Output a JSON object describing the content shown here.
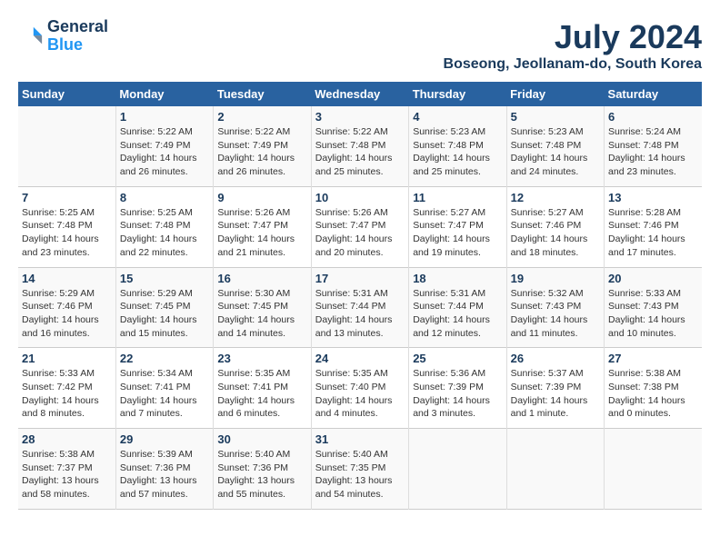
{
  "logo": {
    "line1": "General",
    "line2": "Blue"
  },
  "title": "July 2024",
  "subtitle": "Boseong, Jeollanam-do, South Korea",
  "days_header": [
    "Sunday",
    "Monday",
    "Tuesday",
    "Wednesday",
    "Thursday",
    "Friday",
    "Saturday"
  ],
  "weeks": [
    [
      {
        "num": "",
        "info": ""
      },
      {
        "num": "1",
        "info": "Sunrise: 5:22 AM\nSunset: 7:49 PM\nDaylight: 14 hours\nand 26 minutes."
      },
      {
        "num": "2",
        "info": "Sunrise: 5:22 AM\nSunset: 7:49 PM\nDaylight: 14 hours\nand 26 minutes."
      },
      {
        "num": "3",
        "info": "Sunrise: 5:22 AM\nSunset: 7:48 PM\nDaylight: 14 hours\nand 25 minutes."
      },
      {
        "num": "4",
        "info": "Sunrise: 5:23 AM\nSunset: 7:48 PM\nDaylight: 14 hours\nand 25 minutes."
      },
      {
        "num": "5",
        "info": "Sunrise: 5:23 AM\nSunset: 7:48 PM\nDaylight: 14 hours\nand 24 minutes."
      },
      {
        "num": "6",
        "info": "Sunrise: 5:24 AM\nSunset: 7:48 PM\nDaylight: 14 hours\nand 23 minutes."
      }
    ],
    [
      {
        "num": "7",
        "info": "Sunrise: 5:25 AM\nSunset: 7:48 PM\nDaylight: 14 hours\nand 23 minutes."
      },
      {
        "num": "8",
        "info": "Sunrise: 5:25 AM\nSunset: 7:48 PM\nDaylight: 14 hours\nand 22 minutes."
      },
      {
        "num": "9",
        "info": "Sunrise: 5:26 AM\nSunset: 7:47 PM\nDaylight: 14 hours\nand 21 minutes."
      },
      {
        "num": "10",
        "info": "Sunrise: 5:26 AM\nSunset: 7:47 PM\nDaylight: 14 hours\nand 20 minutes."
      },
      {
        "num": "11",
        "info": "Sunrise: 5:27 AM\nSunset: 7:47 PM\nDaylight: 14 hours\nand 19 minutes."
      },
      {
        "num": "12",
        "info": "Sunrise: 5:27 AM\nSunset: 7:46 PM\nDaylight: 14 hours\nand 18 minutes."
      },
      {
        "num": "13",
        "info": "Sunrise: 5:28 AM\nSunset: 7:46 PM\nDaylight: 14 hours\nand 17 minutes."
      }
    ],
    [
      {
        "num": "14",
        "info": "Sunrise: 5:29 AM\nSunset: 7:46 PM\nDaylight: 14 hours\nand 16 minutes."
      },
      {
        "num": "15",
        "info": "Sunrise: 5:29 AM\nSunset: 7:45 PM\nDaylight: 14 hours\nand 15 minutes."
      },
      {
        "num": "16",
        "info": "Sunrise: 5:30 AM\nSunset: 7:45 PM\nDaylight: 14 hours\nand 14 minutes."
      },
      {
        "num": "17",
        "info": "Sunrise: 5:31 AM\nSunset: 7:44 PM\nDaylight: 14 hours\nand 13 minutes."
      },
      {
        "num": "18",
        "info": "Sunrise: 5:31 AM\nSunset: 7:44 PM\nDaylight: 14 hours\nand 12 minutes."
      },
      {
        "num": "19",
        "info": "Sunrise: 5:32 AM\nSunset: 7:43 PM\nDaylight: 14 hours\nand 11 minutes."
      },
      {
        "num": "20",
        "info": "Sunrise: 5:33 AM\nSunset: 7:43 PM\nDaylight: 14 hours\nand 10 minutes."
      }
    ],
    [
      {
        "num": "21",
        "info": "Sunrise: 5:33 AM\nSunset: 7:42 PM\nDaylight: 14 hours\nand 8 minutes."
      },
      {
        "num": "22",
        "info": "Sunrise: 5:34 AM\nSunset: 7:41 PM\nDaylight: 14 hours\nand 7 minutes."
      },
      {
        "num": "23",
        "info": "Sunrise: 5:35 AM\nSunset: 7:41 PM\nDaylight: 14 hours\nand 6 minutes."
      },
      {
        "num": "24",
        "info": "Sunrise: 5:35 AM\nSunset: 7:40 PM\nDaylight: 14 hours\nand 4 minutes."
      },
      {
        "num": "25",
        "info": "Sunrise: 5:36 AM\nSunset: 7:39 PM\nDaylight: 14 hours\nand 3 minutes."
      },
      {
        "num": "26",
        "info": "Sunrise: 5:37 AM\nSunset: 7:39 PM\nDaylight: 14 hours\nand 1 minute."
      },
      {
        "num": "27",
        "info": "Sunrise: 5:38 AM\nSunset: 7:38 PM\nDaylight: 14 hours\nand 0 minutes."
      }
    ],
    [
      {
        "num": "28",
        "info": "Sunrise: 5:38 AM\nSunset: 7:37 PM\nDaylight: 13 hours\nand 58 minutes."
      },
      {
        "num": "29",
        "info": "Sunrise: 5:39 AM\nSunset: 7:36 PM\nDaylight: 13 hours\nand 57 minutes."
      },
      {
        "num": "30",
        "info": "Sunrise: 5:40 AM\nSunset: 7:36 PM\nDaylight: 13 hours\nand 55 minutes."
      },
      {
        "num": "31",
        "info": "Sunrise: 5:40 AM\nSunset: 7:35 PM\nDaylight: 13 hours\nand 54 minutes."
      },
      {
        "num": "",
        "info": ""
      },
      {
        "num": "",
        "info": ""
      },
      {
        "num": "",
        "info": ""
      }
    ]
  ]
}
